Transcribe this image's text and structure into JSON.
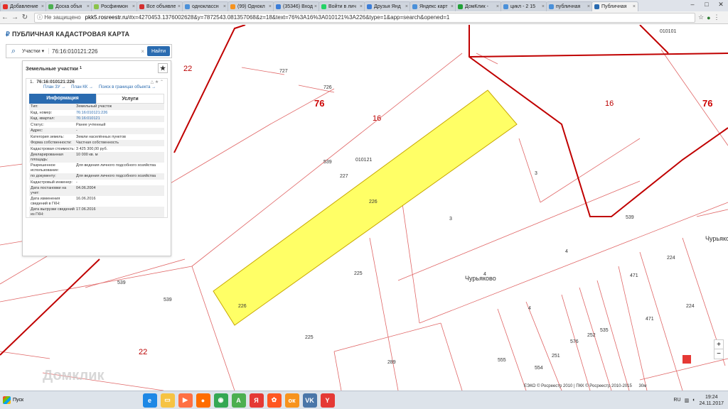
{
  "browser": {
    "tabs": [
      {
        "label": "Добавление",
        "favicon": "youtube-icon",
        "color": "#e52d27"
      },
      {
        "label": "Доска объя",
        "favicon": "board-icon",
        "color": "#4caf50"
      },
      {
        "label": "Росфинмон",
        "favicon": "rosfin-icon",
        "color": "#8bc34a"
      },
      {
        "label": "Все объявле",
        "favicon": "avito-icon",
        "color": "#d32f2f"
      },
      {
        "label": "одноклассн",
        "favicon": "search-icon",
        "color": "#4a90d9"
      },
      {
        "label": "(99) Однокл",
        "favicon": "ok-icon",
        "color": "#f7931e"
      },
      {
        "label": "(35346) Вход",
        "favicon": "mail-icon",
        "color": "#3b7dd8"
      },
      {
        "label": "Войти в лич",
        "favicon": "whatsapp-icon",
        "color": "#25d366"
      },
      {
        "label": "Друзья Янд",
        "favicon": "mail-icon",
        "color": "#3b7dd8"
      },
      {
        "label": "Яндекс карт",
        "favicon": "search-icon",
        "color": "#4a90d9"
      },
      {
        "label": "ДомКлик -",
        "favicon": "domclick-icon",
        "color": "#21a038"
      },
      {
        "label": "цикл - 2 15",
        "favicon": "search-icon",
        "color": "#4a90d9"
      },
      {
        "label": "публичная",
        "favicon": "search-icon",
        "color": "#4a90d9"
      },
      {
        "label": "Публичная",
        "favicon": "pkk-icon",
        "color": "#2a6bb0",
        "active": true
      }
    ],
    "security_label": "Не защищено",
    "url_host": "pkk5.rosreestr.ru",
    "url_rest": "/#x=4270453.1376002628&y=7872543.081357068&z=18&text=76%3A16%3A010121%3A226&type=1&app=search&opened=1"
  },
  "app": {
    "title": "ПУБЛИЧНАЯ КАДАСТРОВАЯ КАРТА",
    "search": {
      "type_label": "Участки",
      "query": "76:16:010121:226",
      "button_label": "Найти"
    },
    "panel": {
      "header": "Земельные участки",
      "header_count": "1",
      "card": {
        "index": "1.",
        "number": "76:16:010121:226",
        "links": [
          "План ЗУ →",
          "План КК →",
          "Поиск в границах объекта →"
        ]
      },
      "tabs": [
        "Информация",
        "Услуги"
      ],
      "rows": [
        {
          "k": "Тип:",
          "v": "Земельный участок"
        },
        {
          "k": "Кад. номер:",
          "v": "76:16:010121:226",
          "link": true
        },
        {
          "k": "Кад. квартал:",
          "v": "76:16:010121",
          "link": true
        },
        {
          "k": "Статус:",
          "v": "Ранее учтенный"
        },
        {
          "k": "Адрес:",
          "v": "-"
        },
        {
          "k": "Категория земель:",
          "v": "Земли населённых пунктов"
        },
        {
          "k": "Форма собственности:",
          "v": "Частная собственность"
        },
        {
          "k": "Кадастровая стоимость:",
          "v": "3 425 300,00 руб."
        },
        {
          "k": "Декларированная площадь:",
          "v": "10 000 кв. м"
        },
        {
          "k": "Разрешенное использование:",
          "v": "Для ведения личного подсобного хозяйства"
        },
        {
          "k": "по документу:",
          "v": "Для ведения личного подсобного хозяйства"
        },
        {
          "k": "Кадастровый инженер:",
          "v": "-"
        },
        {
          "k": "Дата постановки на учет:",
          "v": "04.06.2004"
        },
        {
          "k": "Дата изменения сведений в ГКН:",
          "v": "16.06.2016"
        },
        {
          "k": "Дата выгрузки сведений из ГКН:",
          "v": "17.06.2016"
        }
      ]
    }
  },
  "map": {
    "labels": [
      {
        "t": "010101",
        "cls": ""
      },
      {
        "t": "22",
        "cls": "mid"
      },
      {
        "t": "76",
        "cls": "big"
      },
      {
        "t": "16",
        "cls": "mid"
      },
      {
        "t": "16",
        "cls": "mid"
      },
      {
        "t": "76",
        "cls": "big"
      },
      {
        "t": "010121",
        "cls": ""
      },
      {
        "t": "227",
        "cls": ""
      },
      {
        "t": "226",
        "cls": ""
      },
      {
        "t": "226",
        "cls": ""
      },
      {
        "t": "3",
        "cls": ""
      },
      {
        "t": "3",
        "cls": ""
      },
      {
        "t": "225",
        "cls": ""
      },
      {
        "t": "Чурьяково",
        "cls": "city"
      },
      {
        "t": "4",
        "cls": ""
      },
      {
        "t": "4",
        "cls": ""
      },
      {
        "t": "4",
        "cls": ""
      },
      {
        "t": "471",
        "cls": ""
      },
      {
        "t": "471",
        "cls": ""
      },
      {
        "t": "224",
        "cls": ""
      },
      {
        "t": "224",
        "cls": ""
      },
      {
        "t": "Чурьяко",
        "cls": "city"
      },
      {
        "t": "22",
        "cls": "mid"
      },
      {
        "t": "225",
        "cls": ""
      },
      {
        "t": "289",
        "cls": ""
      },
      {
        "t": "555",
        "cls": ""
      },
      {
        "t": "554",
        "cls": ""
      },
      {
        "t": "251",
        "cls": ""
      },
      {
        "t": "576",
        "cls": ""
      },
      {
        "t": "252",
        "cls": ""
      },
      {
        "t": "535",
        "cls": ""
      },
      {
        "t": "539",
        "cls": ""
      },
      {
        "t": "539",
        "cls": ""
      },
      {
        "t": "539",
        "cls": ""
      },
      {
        "t": "539",
        "cls": ""
      },
      {
        "t": "726",
        "cls": ""
      },
      {
        "t": "727",
        "cls": ""
      }
    ],
    "attribution": "ЕЭКО © Росреестр 2010 | ПКК © Росреестр 2010-2015",
    "scale": "30м",
    "watermark": "Домклик",
    "zoom_in": "+",
    "zoom_out": "−"
  },
  "taskbar": {
    "start_label": "Пуск",
    "lang": "RU",
    "time": "19:24",
    "date": "24.11.2017",
    "apps": [
      {
        "icon": "ie-icon",
        "color": "#1e88e5",
        "g": "e"
      },
      {
        "icon": "folder-icon",
        "color": "#f6c343",
        "g": "▭"
      },
      {
        "icon": "media-icon",
        "color": "#ff7043",
        "g": "▶"
      },
      {
        "icon": "firefox-icon",
        "color": "#ff6d00",
        "g": "●"
      },
      {
        "icon": "chrome-icon",
        "color": "#34a853",
        "g": "◉"
      },
      {
        "icon": "amigo-icon",
        "color": "#4caf50",
        "g": "A"
      },
      {
        "icon": "yandex-icon",
        "color": "#e53935",
        "g": "Я"
      },
      {
        "icon": "games-icon",
        "color": "#ff5722",
        "g": "✿"
      },
      {
        "icon": "odnoklassniki-icon",
        "color": "#f7931e",
        "g": "ок"
      },
      {
        "icon": "vk-icon",
        "color": "#4a76a8",
        "g": "VK"
      },
      {
        "icon": "yandex-browser-icon",
        "color": "#e53935",
        "g": "Y"
      }
    ]
  }
}
